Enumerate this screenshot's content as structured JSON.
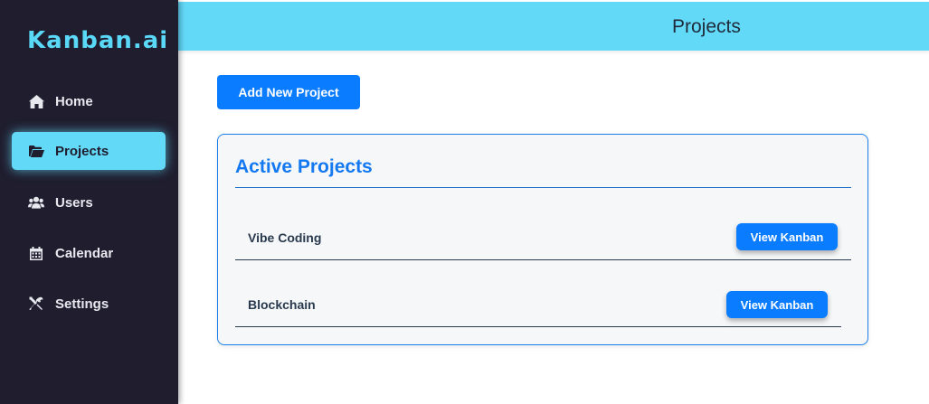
{
  "app": {
    "brand": "Kanban.ai"
  },
  "sidebar": {
    "items": [
      {
        "label": "Home",
        "icon": "home-icon",
        "active": false
      },
      {
        "label": "Projects",
        "icon": "folder-open-icon",
        "active": true
      },
      {
        "label": "Users",
        "icon": "users-icon",
        "active": false
      },
      {
        "label": "Calendar",
        "icon": "calendar-icon",
        "active": false
      },
      {
        "label": "Settings",
        "icon": "tools-icon",
        "active": false
      }
    ]
  },
  "header": {
    "title": "Projects"
  },
  "main": {
    "add_button_label": "Add New Project",
    "card": {
      "title": "Active Projects",
      "projects": [
        {
          "name": "Vibe Coding",
          "action_label": "View Kanban"
        },
        {
          "name": "Blockchain",
          "action_label": "View Kanban"
        }
      ]
    }
  },
  "colors": {
    "sidebar_bg": "#1f1d2e",
    "accent_cyan": "#63d9f8",
    "primary_blue": "#0a7cff"
  }
}
